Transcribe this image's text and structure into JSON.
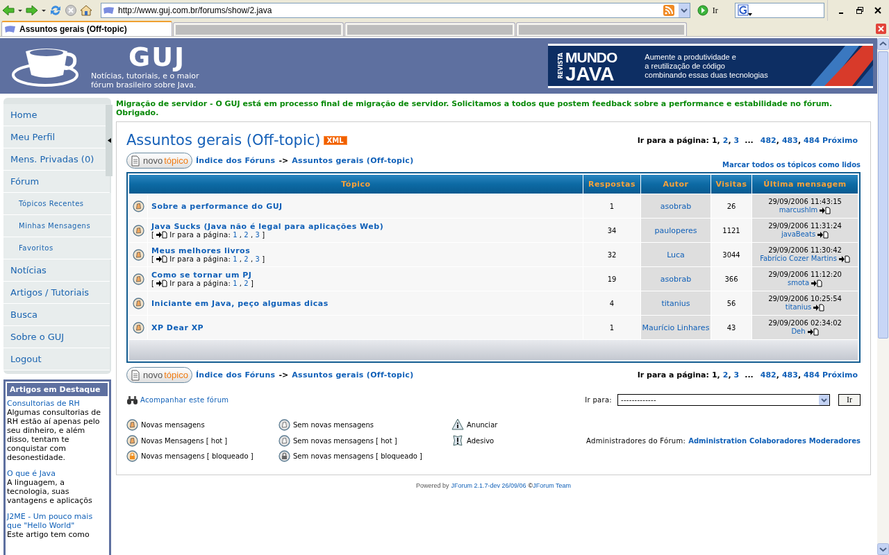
{
  "browser": {
    "url": "http://www.guj.com.br/forums/show/2.java",
    "go_label": "Ir",
    "tabs": [
      {
        "label": "Assuntos gerais (Off-topic)",
        "selected": true
      },
      {
        "selected": false
      },
      {
        "selected": false
      },
      {
        "selected": false
      }
    ]
  },
  "header": {
    "logo": "GUJ",
    "tagline": "Notícias, tutoriais, e o maior fórum brasileiro sobre Java.",
    "ad": {
      "side": "REVISTA",
      "top": "MUNDO",
      "bottom": "JAVA",
      "lines": [
        "Aumente a produtividade e",
        "a reutilização de código",
        "combinando essas duas tecnologias"
      ]
    }
  },
  "sidebar": {
    "items": [
      {
        "label": "Home",
        "kind": "main"
      },
      {
        "label": "Meu Perfil",
        "kind": "main"
      },
      {
        "label": "Mens. Privadas (0)",
        "kind": "main"
      },
      {
        "label": "Fórum",
        "kind": "main"
      },
      {
        "label": "Tópicos Recentes",
        "kind": "sub"
      },
      {
        "label": "Minhas Mensagens",
        "kind": "sub"
      },
      {
        "label": "Favoritos",
        "kind": "sub"
      },
      {
        "label": "Notícias",
        "kind": "main"
      },
      {
        "label": "Artigos / Tutoriais",
        "kind": "main"
      },
      {
        "label": "Busca",
        "kind": "main"
      },
      {
        "label": "Sobre o GUJ",
        "kind": "main"
      },
      {
        "label": "Logout",
        "kind": "main"
      }
    ],
    "featured": {
      "title": "Artigos em Destaque",
      "articles": [
        {
          "title": "Consultorias de RH",
          "summary": "Algumas consultorias de RH estão aí apenas pelo seu dinheiro, e além disso, tentam te conquistar com desonestidade."
        },
        {
          "title": "O que é Java",
          "summary": "A linguagem, a tecnologia, suas vantagens e aplicaçõs"
        },
        {
          "title": "J2ME - Um pouco mais que \"Hello World\"",
          "summary": "Este artigo tem como"
        }
      ]
    }
  },
  "notice": "Migração de servidor - O GUJ está em processo final de migração de servidor. Solicitamos a todos que postem feedback sobre a performance e estabilidade no fórum. Obrigado.",
  "forum": {
    "title": "Assuntos gerais (Off-topic)",
    "feed_badge": "XML",
    "breadcrumb_top": {
      "button_first": "novo",
      "button_second": "tópico",
      "home": "Índice dos Fóruns",
      "arrow": "->",
      "current": "Assuntos gerais (Off-topic)"
    },
    "pagination_top": [
      {
        "text": "Ir para a página:",
        "kind": "label"
      },
      {
        "text": "1",
        "kind": "current"
      },
      {
        "text": ",",
        "kind": "sep"
      },
      {
        "text": "2",
        "kind": "link"
      },
      {
        "text": ",",
        "kind": "sep"
      },
      {
        "text": "3",
        "kind": "link"
      },
      {
        "text": "...",
        "kind": "ellipsis"
      },
      {
        "text": "482",
        "kind": "link"
      },
      {
        "text": ",",
        "kind": "sep"
      },
      {
        "text": "483",
        "kind": "link"
      },
      {
        "text": ",",
        "kind": "sep"
      },
      {
        "text": "484",
        "kind": "link"
      },
      {
        "text": "Próximo",
        "kind": "link"
      }
    ],
    "mark_all_read": "Marcar todos os tópicos como lidos",
    "table": {
      "columns": [
        "Tópico",
        "Respostas",
        "Autor",
        "Visitas",
        "Última mensagem"
      ],
      "rows": [
        {
          "title": "Sobre a performance do GUJ",
          "replies": "1",
          "author": "asobrab",
          "views": "26",
          "last_date": "29/09/2006 11:43:15",
          "last_user": "marcushlm"
        },
        {
          "title": "Java Sucks (Java não é legal para aplicações Web)",
          "pages": {
            "open": "[",
            "label": "Ir para a página:",
            "items": [
              "1",
              "2",
              "3"
            ],
            "sep": ",",
            "close": "]"
          },
          "replies": "34",
          "author": "pauloperes",
          "views": "1121",
          "last_date": "29/09/2006 11:31:24",
          "last_user": "javaBeats"
        },
        {
          "title": "Meus melhores livros",
          "pages": {
            "open": "[",
            "label": "Ir para a página:",
            "items": [
              "1",
              "2",
              "3"
            ],
            "sep": ",",
            "close": "]"
          },
          "replies": "32",
          "author": "Luca",
          "views": "3044",
          "last_date": "29/09/2006 11:30:42",
          "last_user": "Fabrício Cozer Martins"
        },
        {
          "title": "Como se tornar um PJ",
          "pages": {
            "open": "[",
            "label": "Ir para a página:",
            "items": [
              "1",
              "2"
            ],
            "sep": ",",
            "close": "]"
          },
          "replies": "19",
          "author": "asobrab",
          "views": "366",
          "last_date": "29/09/2006 11:12:20",
          "last_user": "smota"
        },
        {
          "title": "Iniciante em Java, peço algumas dicas",
          "replies": "4",
          "author": "titanius",
          "views": "56",
          "last_date": "29/09/2006 10:25:54",
          "last_user": "titanius"
        },
        {
          "title": "XP Dear XP",
          "replies": "1",
          "author": "Maurício Linhares",
          "views": "43",
          "last_date": "29/09/2006 02:34:02",
          "last_user": "Deh"
        }
      ]
    },
    "breadcrumb_bottom": {
      "button_first": "novo",
      "button_second": "tópico",
      "home": "Índice dos Fóruns",
      "arrow": "->",
      "current": "Assuntos gerais (Off-topic)"
    },
    "pagination_bottom": [
      {
        "text": "Ir para a página:",
        "kind": "label"
      },
      {
        "text": "1",
        "kind": "current"
      },
      {
        "text": ",",
        "kind": "sep"
      },
      {
        "text": "2",
        "kind": "link"
      },
      {
        "text": ",",
        "kind": "sep"
      },
      {
        "text": "3",
        "kind": "link"
      },
      {
        "text": "...",
        "kind": "ellipsis"
      },
      {
        "text": "482",
        "kind": "link"
      },
      {
        "text": ",",
        "kind": "sep"
      },
      {
        "text": "483",
        "kind": "link"
      },
      {
        "text": ",",
        "kind": "sep"
      },
      {
        "text": "484",
        "kind": "link"
      },
      {
        "text": "Próximo",
        "kind": "link"
      }
    ],
    "watch": "Acompanhar este fórum",
    "jump": {
      "label": "Ir para:",
      "value": "-------------",
      "button": "Ir"
    },
    "legend": [
      {
        "label": "Novas mensagens",
        "kind": "new"
      },
      {
        "label": "Sem novas mensagens",
        "kind": "none"
      },
      {
        "label": "Anunciar",
        "kind": "announce"
      },
      {
        "label": "Novas Mensagens [ hot ]",
        "kind": "new"
      },
      {
        "label": "Sem novas mensagens [ hot ]",
        "kind": "none"
      },
      {
        "label": "Adesivo",
        "kind": "sticky"
      },
      {
        "label": "Novas mensagens [ bloqueado ]",
        "kind": "new_locked"
      },
      {
        "label": "Sem novas mensagens [ bloqueado ]",
        "kind": "none_locked"
      }
    ],
    "moderators": {
      "label": "Administradores do Fórum:",
      "groups": [
        "Administration",
        "Colaboradores",
        "Moderadores"
      ]
    }
  },
  "footer": {
    "prefix": "Powered by",
    "version": "JForum 2.1.7-dev 26/09/06",
    "copyright": "©",
    "team": "JForum Team"
  }
}
